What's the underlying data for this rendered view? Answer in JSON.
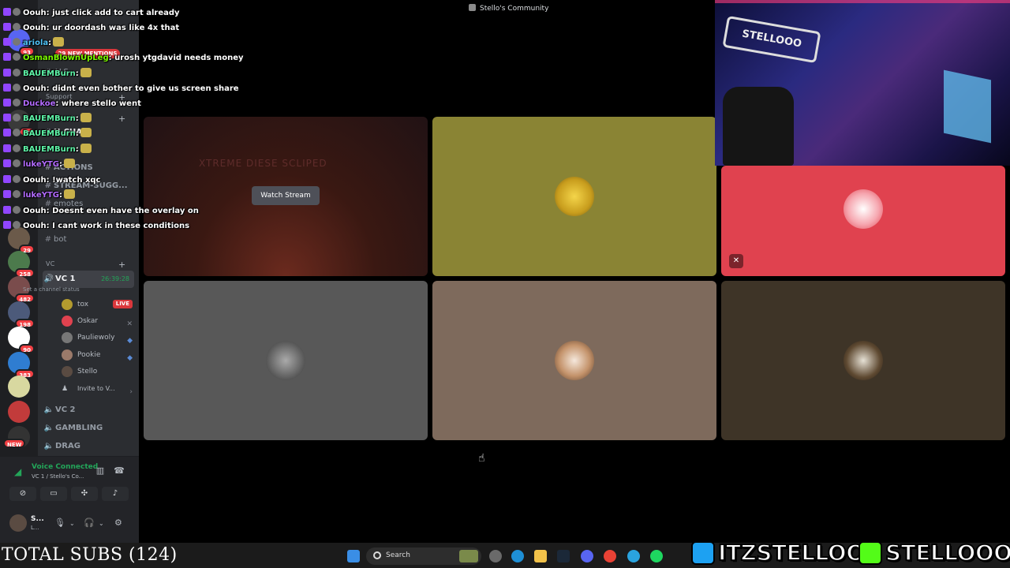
{
  "window": {
    "title": "Stello's Community"
  },
  "rail": {
    "badges": [
      "93",
      "13",
      "29",
      "258",
      "482",
      "198",
      "90",
      "383",
      "NEW"
    ]
  },
  "sidebar": {
    "mentions_banner": "29 NEW MENTIONS",
    "categories": {
      "support": "Support",
      "channels": "Channels",
      "vc": "VC"
    },
    "channels": [
      "ALS",
      "N-CHAT",
      "S",
      "ACTIONS",
      "STREAM-SUGG...",
      "emotes",
      "bot"
    ],
    "voice": {
      "active_name": "VC 1",
      "active_timer": "26:39:28",
      "status_hint": "Set a channel status",
      "users": [
        {
          "name": "tox",
          "live": "LIVE"
        },
        {
          "name": "Oskar"
        },
        {
          "name": "Pauliewoly"
        },
        {
          "name": "Pookie"
        },
        {
          "name": "Stello"
        }
      ],
      "invite": "Invite to V...",
      "other_channels": [
        "VC 2",
        "GAMBLING",
        "DRAG"
      ]
    },
    "voice_panel": {
      "title": "Voice Connected",
      "subtitle": "VC 1 / Stello's Co..."
    },
    "user_panel": {
      "name": "S...",
      "status": "L..."
    }
  },
  "chat": [
    {
      "user": "Oouh",
      "color": "#ffffff",
      "text": ": just click add to cart already"
    },
    {
      "user": "Oouh",
      "color": "#ffffff",
      "text": ": ur doordash was like 4x that"
    },
    {
      "user": "ariola",
      "color": "#4fc3f7",
      "text": ":"
    },
    {
      "user": "OsmanBlownUpLeg",
      "color": "#7cfc00",
      "text": ": urosh ytgdavid needs money"
    },
    {
      "user": "BAUEMBurn",
      "color": "#5ef4a8",
      "text": ":"
    },
    {
      "user": "Oouh",
      "color": "#ffffff",
      "text": ": didnt even bother to give us screen share"
    },
    {
      "user": "Duckoe",
      "color": "#b36bff",
      "text": ": where stello went"
    },
    {
      "user": "BAUEMBurn",
      "color": "#5ef4a8",
      "text": ":"
    },
    {
      "user": "BAUEMBurn",
      "color": "#5ef4a8",
      "text": ":"
    },
    {
      "user": "BAUEMBurn",
      "color": "#5ef4a8",
      "text": ":"
    },
    {
      "user": "lukeYTG",
      "color": "#b36bff",
      "text": ":"
    },
    {
      "user": "Oouh",
      "color": "#ffffff",
      "text": ": !watch xqc"
    },
    {
      "user": "lukeYTG",
      "color": "#b36bff",
      "text": ":"
    },
    {
      "user": "Oouh",
      "color": "#ffffff",
      "text": ": Doesnt even have the overlay on"
    },
    {
      "user": "Oouh",
      "color": "#ffffff",
      "text": ": I cant work in these conditions"
    }
  ],
  "tiles": {
    "stream": {
      "button": "Watch Stream",
      "bg_text": "XTREME DIESE SCLIPED"
    },
    "colors": [
      "#8a8434",
      "#e0424f",
      "#585858",
      "#7e6a5c",
      "#3e3427"
    ]
  },
  "webcam": {
    "sign_text": "STELLOOO"
  },
  "taskbar": {
    "search": "Search"
  },
  "overlay": {
    "subs": "TOTAL SUBS (124)",
    "twitter": "ITZSTELLOO",
    "kick": "STELLOOO"
  }
}
